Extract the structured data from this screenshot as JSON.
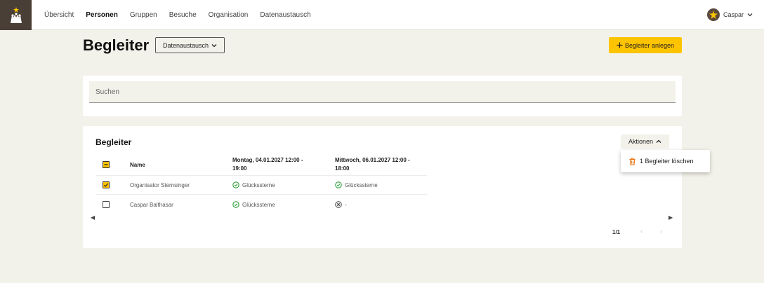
{
  "nav": {
    "items": [
      "Übersicht",
      "Personen",
      "Gruppen",
      "Besuche",
      "Organisation",
      "Datenaustausch"
    ],
    "active": "Personen"
  },
  "user": {
    "name": "Caspar"
  },
  "header": {
    "title": "Begleiter",
    "dropdown_label": "Datenaustausch",
    "add_button_label": "Begleiter anlegen"
  },
  "search": {
    "placeholder": "Suchen"
  },
  "table_card": {
    "title": "Begleiter",
    "actions_label": "Aktionen",
    "columns": [
      "Name",
      "Montag, 04.01.2027 12:00 -",
      "19:00",
      "Mittwoch, 06.01.2027 12:00 -",
      "18:00"
    ],
    "rows": [
      {
        "name": "Organisator Sternsinger",
        "checked": true,
        "col1": "Glückssterne",
        "col1_status": "ok",
        "col2": "Glückssterne",
        "col2_status": "ok"
      },
      {
        "name": "Caspar Balthasar",
        "checked": false,
        "col1": "Glückssterne",
        "col1_status": "ok",
        "col2": "-",
        "col2_status": "no"
      }
    ],
    "pager": "1/1"
  },
  "actions_menu": {
    "delete_label": "1 Begleiter löschen"
  },
  "colors": {
    "accent": "#ffc400",
    "ok": "#2e9e3a",
    "delete": "#e8710a",
    "logo_bg": "#4a3f36"
  }
}
